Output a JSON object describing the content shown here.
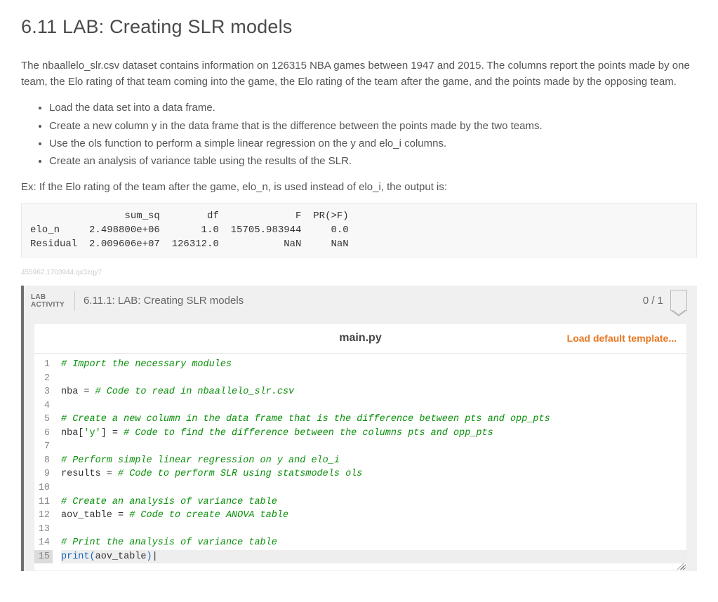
{
  "title": "6.11 LAB: Creating SLR models",
  "intro": "The nbaallelo_slr.csv dataset contains information on 126315 NBA games between 1947 and 2015. The columns report the points made by one team, the Elo rating of that team coming into the game, the Elo rating of the team after the game, and the points made by the opposing team.",
  "bullets": [
    "Load the data set into a data frame.",
    "Create a new column y in the data frame that is the difference between the points made by the two teams.",
    "Use the ols function to perform a simple linear regression on the y and elo_i columns.",
    "Create an analysis of variance table using the results of the SLR."
  ],
  "example_lead": "Ex: If the Elo rating of the team after the game, elo_n, is used instead of elo_i, the output is:",
  "output_text": "                sum_sq        df             F  PR(>F)\nelo_n     2.498800e+06       1.0  15705.983944     0.0\nResidual  2.009606e+07  126312.0           NaN     NaN",
  "watermark": "455962.1703944.qx3zqy7",
  "activity": {
    "tag_line1": "LAB",
    "tag_line2": "ACTIVITY",
    "title": "6.11.1: LAB: Creating SLR models",
    "score": "0 / 1"
  },
  "editor": {
    "filename": "main.py",
    "load_template": "Load default template...",
    "lines": [
      {
        "n": 1,
        "kind": "comment",
        "text": "# Import the necessary modules"
      },
      {
        "n": 2,
        "kind": "blank",
        "text": ""
      },
      {
        "n": 3,
        "kind": "mixed",
        "prefix": "nba = ",
        "comment": "# Code to read in nbaallelo_slr.csv"
      },
      {
        "n": 4,
        "kind": "blank",
        "text": ""
      },
      {
        "n": 5,
        "kind": "comment",
        "text": "# Create a new column in the data frame that is the difference between pts and opp_pts"
      },
      {
        "n": 6,
        "kind": "mixed",
        "prefix": "nba[",
        "str": "'y'",
        "mid": "] = ",
        "comment": "# Code to find the difference between the columns pts and opp_pts"
      },
      {
        "n": 7,
        "kind": "blank",
        "text": ""
      },
      {
        "n": 8,
        "kind": "comment",
        "text": "# Perform simple linear regression on y and elo_i"
      },
      {
        "n": 9,
        "kind": "mixed",
        "prefix": "results = ",
        "comment": "# Code to perform SLR using statsmodels ols"
      },
      {
        "n": 10,
        "kind": "blank",
        "text": ""
      },
      {
        "n": 11,
        "kind": "comment",
        "text": "# Create an analysis of variance table"
      },
      {
        "n": 12,
        "kind": "mixed",
        "prefix": "aov_table = ",
        "comment": "# Code to create ANOVA table"
      },
      {
        "n": 13,
        "kind": "blank",
        "text": ""
      },
      {
        "n": 14,
        "kind": "comment",
        "text": "# Print the analysis of variance table"
      },
      {
        "n": 15,
        "kind": "print",
        "kw": "print",
        "arg": "aov_table",
        "active": true
      }
    ]
  }
}
